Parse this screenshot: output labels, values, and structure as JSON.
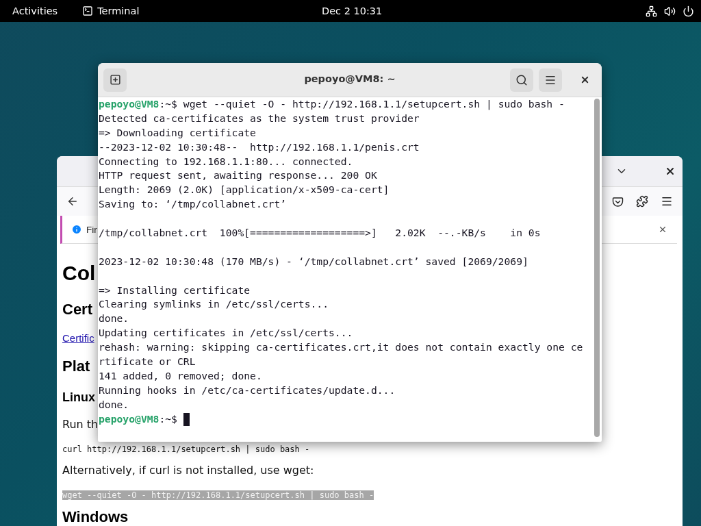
{
  "top_bar": {
    "activities": "Activities",
    "app_name": "Terminal",
    "clock": "Dec 2  10:31"
  },
  "browser": {
    "notification": "Fir",
    "content": [
      {
        "kind": "h1",
        "text": "Col"
      },
      {
        "kind": "h2",
        "text": "Cert"
      },
      {
        "kind": "link",
        "text": "Certific"
      },
      {
        "kind": "h2",
        "text": "Plat"
      },
      {
        "kind": "h3",
        "text": "Linux"
      },
      {
        "kind": "p",
        "text": "Run th"
      },
      {
        "kind": "code",
        "text": "curl http://192.168.1.1/setupcert.sh | sudo bash -",
        "selected": false
      },
      {
        "kind": "p",
        "text": "Alternatively, if curl is not installed, use wget:"
      },
      {
        "kind": "code",
        "text": "wget --quiet -O - http://192.168.1.1/setupcert.sh | sudo bash -",
        "selected": true
      },
      {
        "kind": "h2",
        "text": "Windows"
      }
    ]
  },
  "terminal": {
    "title": "pepoyo@VM8: ~",
    "lines": [
      {
        "kind": "prompt",
        "user": "pepoyo@VM8",
        "path": ":~$ ",
        "text": "wget --quiet -O - http://192.168.1.1/setupcert.sh | sudo bash -",
        "cursor": false
      },
      {
        "kind": "output",
        "text": "Detected ca-certificates as the system trust provider"
      },
      {
        "kind": "output",
        "text": "=> Downloading certificate"
      },
      {
        "kind": "output",
        "text": "--2023-12-02 10:30:48--  http://192.168.1.1/penis.crt"
      },
      {
        "kind": "output",
        "text": "Connecting to 192.168.1.1:80... connected."
      },
      {
        "kind": "output",
        "text": "HTTP request sent, awaiting response... 200 OK"
      },
      {
        "kind": "output",
        "text": "Length: 2069 (2.0K) [application/x-x509-ca-cert]"
      },
      {
        "kind": "output",
        "text": "Saving to: ‘/tmp/collabnet.crt’"
      },
      {
        "kind": "blank"
      },
      {
        "kind": "output",
        "text": "/tmp/collabnet.crt  100%[===================>]   2.02K  --.-KB/s    in 0s"
      },
      {
        "kind": "blank"
      },
      {
        "kind": "output",
        "text": "2023-12-02 10:30:48 (170 MB/s) - ‘/tmp/collabnet.crt’ saved [2069/2069]"
      },
      {
        "kind": "blank"
      },
      {
        "kind": "output",
        "text": "=> Installing certificate"
      },
      {
        "kind": "output",
        "text": "Clearing symlinks in /etc/ssl/certs..."
      },
      {
        "kind": "output",
        "text": "done."
      },
      {
        "kind": "output",
        "text": "Updating certificates in /etc/ssl/certs..."
      },
      {
        "kind": "output",
        "text": "rehash: warning: skipping ca-certificates.crt,it does not contain exactly one ce"
      },
      {
        "kind": "output",
        "text": "rtificate or CRL"
      },
      {
        "kind": "output",
        "text": "141 added, 0 removed; done."
      },
      {
        "kind": "output",
        "text": "Running hooks in /etc/ca-certificates/update.d..."
      },
      {
        "kind": "output",
        "text": "done."
      },
      {
        "kind": "prompt",
        "user": "pepoyo@VM8",
        "path": ":~$ ",
        "cursor": true
      }
    ]
  }
}
